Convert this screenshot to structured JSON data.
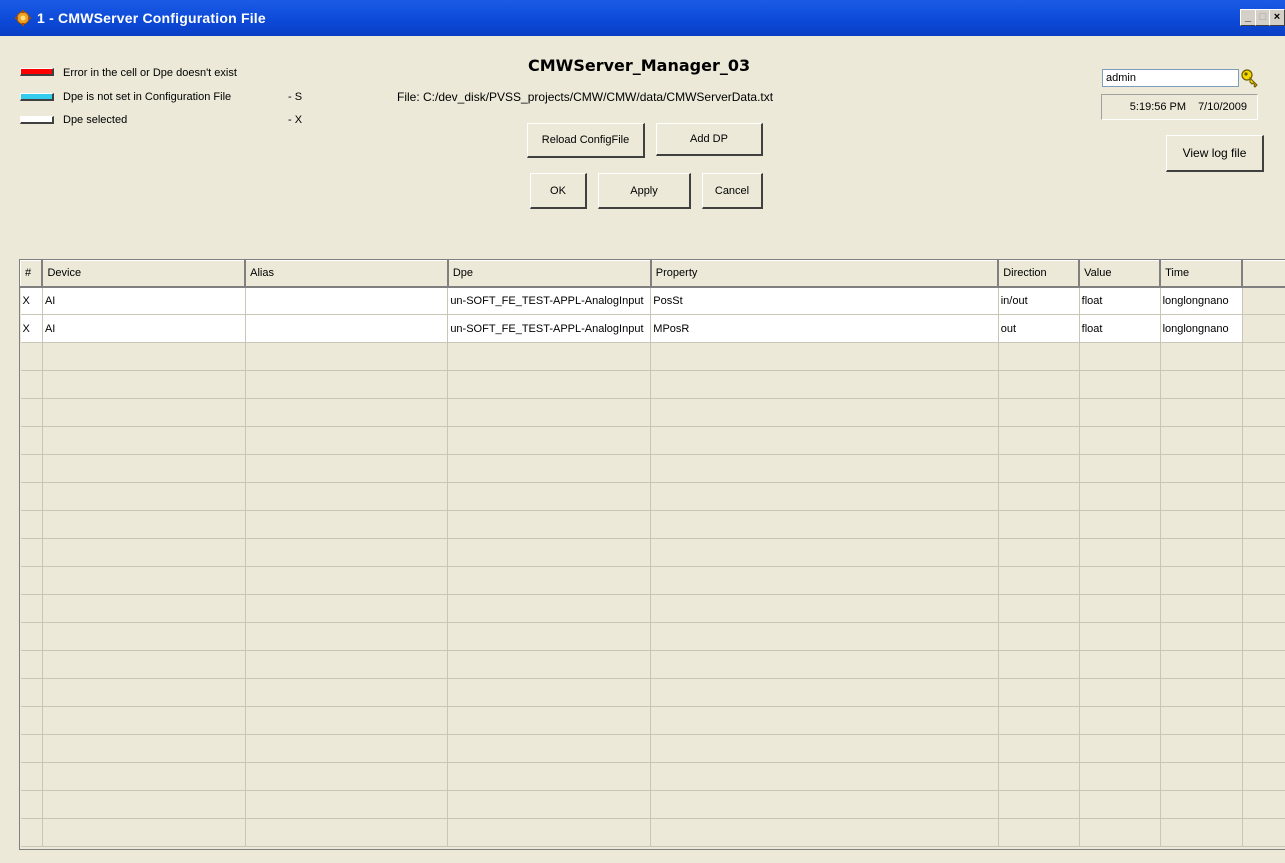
{
  "window": {
    "title": "1 - CMWServer Configuration File",
    "minimize_label": "_",
    "maximize_label": "□",
    "close_label": "×"
  },
  "legend": [
    {
      "label": "Error in the cell or Dpe doesn't exist",
      "code": "",
      "color": "#ff0000"
    },
    {
      "label": "Dpe is not set in Configuration File",
      "code": "- S",
      "color": "#33ccee"
    },
    {
      "label": "Dpe selected",
      "code": "- X",
      "color": "#ffffff"
    }
  ],
  "header": {
    "app_title": "CMWServer_Manager_03",
    "file_path": "File: C:/dev_disk/PVSS_projects/CMW/CMW/data/CMWServerData.txt"
  },
  "buttons": {
    "reload": "Reload ConfigFile",
    "add_dp": "Add DP",
    "ok": "OK",
    "apply": "Apply",
    "cancel": "Cancel",
    "view_log": "View log file"
  },
  "user": {
    "value": "admin",
    "key_icon": "key-icon"
  },
  "clock": {
    "time": "5:19:56 PM",
    "date": "7/10/2009"
  },
  "table": {
    "columns": [
      "#",
      "Device",
      "Alias",
      "Dpe",
      "Property",
      "Direction",
      "Value",
      "Time"
    ],
    "rows": [
      [
        "X",
        "AI",
        "",
        "un-SOFT_FE_TEST-APPL-AnalogInput",
        "PosSt",
        "in/out",
        "float",
        "longlongnano"
      ],
      [
        "X",
        "AI",
        "",
        "un-SOFT_FE_TEST-APPL-AnalogInput",
        "MPosR",
        "out",
        "float",
        "longlongnano"
      ]
    ],
    "empty_rows": 18
  },
  "colors": {
    "titlebar": "#0c48d6",
    "window_bg": "#ece9d8",
    "error": "#ff0000",
    "not_set": "#33ccee",
    "selected": "#ffffff"
  }
}
